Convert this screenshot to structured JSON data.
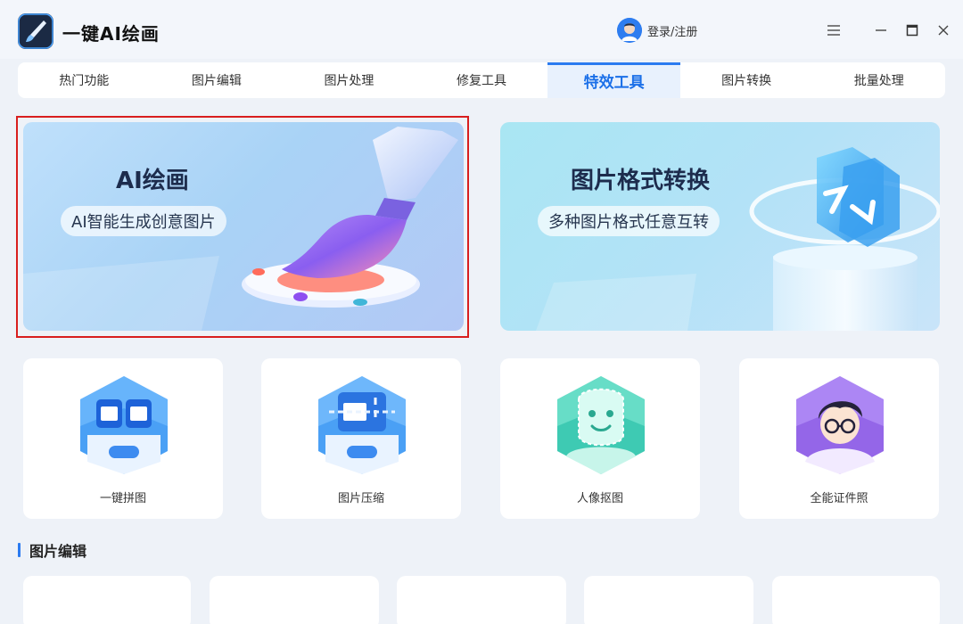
{
  "app": {
    "title": "一键AI绘画",
    "login_label": "登录/注册"
  },
  "tabs": [
    {
      "label": "热门功能",
      "active": false
    },
    {
      "label": "图片编辑",
      "active": false
    },
    {
      "label": "图片处理",
      "active": false
    },
    {
      "label": "修复工具",
      "active": false
    },
    {
      "label": "特效工具",
      "active": true
    },
    {
      "label": "图片转换",
      "active": false
    },
    {
      "label": "批量处理",
      "active": false
    }
  ],
  "banners": [
    {
      "title": "AI绘画",
      "subtitle": "AI智能生成创意图片",
      "icon": "paintbrush-palette-icon"
    },
    {
      "title": "图片格式转换",
      "subtitle": "多种图片格式任意互转",
      "icon": "format-convert-icon"
    }
  ],
  "features": [
    {
      "label": "一键拼图",
      "icon": "collage-icon"
    },
    {
      "label": "图片压缩",
      "icon": "compress-icon"
    },
    {
      "label": "人像抠图",
      "icon": "portrait-cutout-icon"
    },
    {
      "label": "全能证件照",
      "icon": "id-photo-icon"
    }
  ],
  "section": {
    "title": "图片编辑"
  },
  "colors": {
    "accent": "#2b7bf0",
    "selection": "#d81e1e",
    "background": "#eef2f8"
  }
}
